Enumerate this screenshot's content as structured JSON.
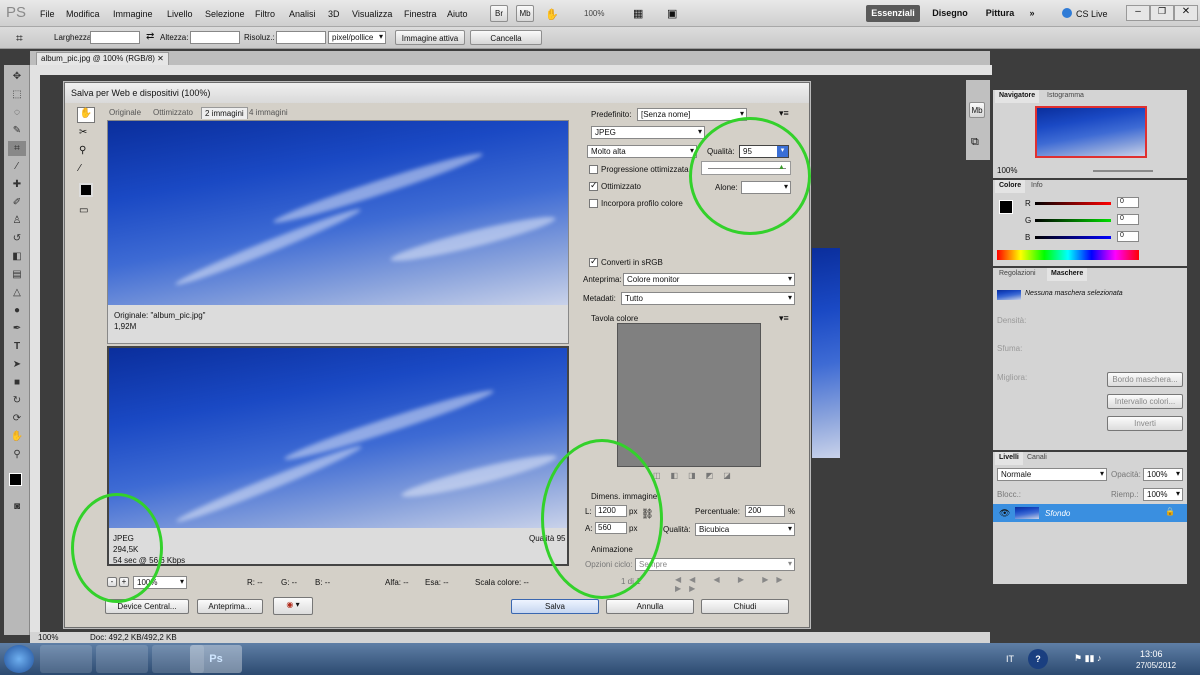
{
  "app": {
    "logo": "PS"
  },
  "menu": [
    "File",
    "Modifica",
    "Immagine",
    "Livello",
    "Selezione",
    "Filtro",
    "Analisi",
    "3D",
    "Visualizza",
    "Finestra",
    "Aiuto"
  ],
  "menubar_buttons": {
    "br": "Br",
    "mb": "Mb",
    "zoom": "100%"
  },
  "workspaces": {
    "active": "Essenziali",
    "items": [
      "Disegno",
      "Pittura"
    ],
    "more": "»",
    "cslive": "CS Live"
  },
  "options": {
    "width_label": "Larghezza:",
    "height_label": "Altezza:",
    "res_label": "Risoluz.:",
    "unit": "pixel/pollice",
    "active_image": "Immagine attiva",
    "cancel": "Cancella"
  },
  "doc_tab": "album_pic.jpg @ 100% (RGB/8)",
  "dialog": {
    "title": "Salva per Web e dispositivi (100%)",
    "tabs": [
      "Originale",
      "Ottimizzato",
      "2 immagini",
      "4 immagini"
    ],
    "original_label": "Originale: \"album_pic.jpg\"",
    "original_size": "1,92M",
    "opt_format": "JPEG",
    "opt_size": "294,5K",
    "opt_time": "54 sec @ 56,6 Kbps",
    "opt_quality": "Qualità 95",
    "zoom": "100%",
    "readouts": {
      "r": "R: --",
      "g": "G: --",
      "b": "B: --",
      "alfa": "Alfa: --",
      "esa": "Esa: --",
      "scale": "Scala colore: --"
    },
    "preset_label": "Predefinito:",
    "preset": "[Senza nome]",
    "format": "JPEG",
    "compression": "Molto alta",
    "quality_label": "Qualità:",
    "quality": "95",
    "progressive": "Progressione ottimizzata",
    "optimized": "Ottimizzato",
    "halo_label": "Alone:",
    "embed_profile": "Incorpora profilo colore",
    "convert_srgb": "Converti in sRGB",
    "preview_label": "Anteprima:",
    "preview_value": "Colore monitor",
    "meta_label": "Metadati:",
    "meta_value": "Tutto",
    "color_table": "Tavola colore",
    "image_size": "Dimens. immagine",
    "w_label": "L:",
    "w": "1200",
    "h_label": "A:",
    "h": "560",
    "px": "px",
    "percent_label": "Percentuale:",
    "percent": "200",
    "pct": "%",
    "resample_label": "Qualità:",
    "resample": "Bicubica",
    "animation": "Animazione",
    "loop_label": "Opzioni ciclo:",
    "loop": "Sempre",
    "frame": "1 di 1",
    "buttons": {
      "device": "Device Central...",
      "preview": "Anteprima...",
      "save": "Salva",
      "cancel": "Annulla",
      "done": "Chiudi"
    }
  },
  "navigator": {
    "tabs": [
      "Navigatore",
      "Istogramma"
    ],
    "zoom": "100%"
  },
  "color": {
    "tabs": [
      "Colore",
      "Info"
    ],
    "r": "0",
    "g": "0",
    "b": "0",
    "rl": "R",
    "gl": "G",
    "bl": "B"
  },
  "masks": {
    "tabs": [
      "Regolazioni",
      "Maschere"
    ],
    "none": "Nessuna maschera selezionata",
    "density": "Densità:",
    "feather": "Sfuma:",
    "refine": "Migliora:",
    "edge": "Bordo maschera...",
    "range": "Intervallo colori...",
    "invert": "Inverti"
  },
  "layers": {
    "tabs": [
      "Livelli",
      "Canali"
    ],
    "mode": "Normale",
    "opacity_label": "Opacità:",
    "opacity": "100%",
    "lock": "Blocc.:",
    "fill_label": "Riemp.:",
    "fill": "100%",
    "layer": "Sfondo"
  },
  "status": {
    "zoom": "100%",
    "doc": "Doc: 492,2 KB/492,2 KB"
  },
  "taskbar": {
    "lang": "IT",
    "time": "13:06",
    "date": "27/05/2012",
    "ps": "Ps"
  }
}
